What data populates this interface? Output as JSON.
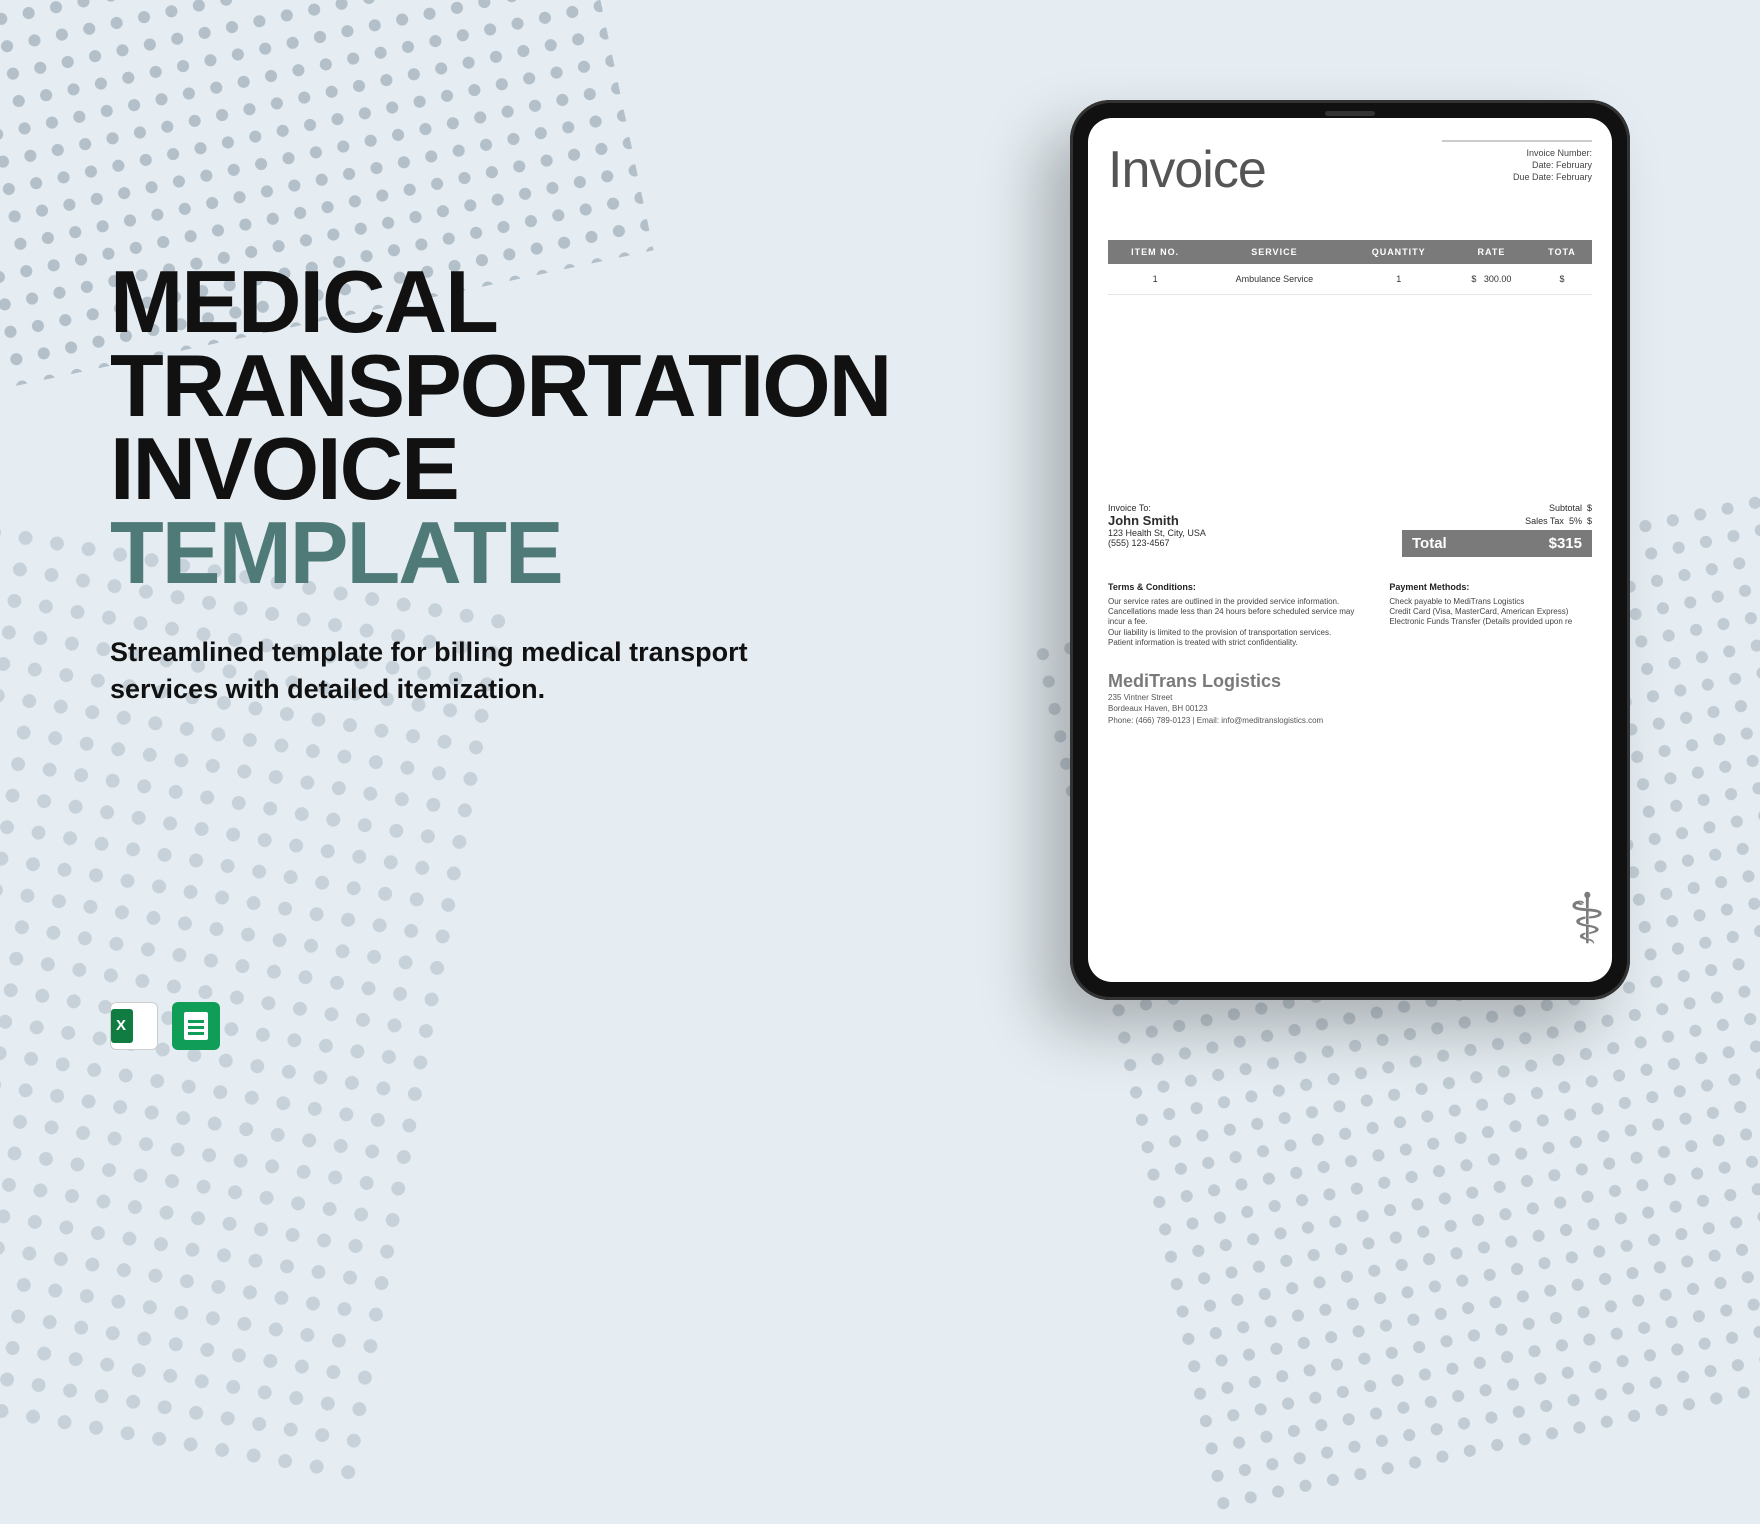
{
  "hero": {
    "title_line1": "MEDICAL",
    "title_line2": "TRANSPORTATION",
    "title_line3a": "INVOICE ",
    "title_line3b_accent": "TEMPLATE",
    "subtitle": "Streamlined template for billing medical transport services with detailed itemization."
  },
  "file_icons": {
    "excel": "excel-icon",
    "sheets": "google-sheets-icon"
  },
  "invoice": {
    "heading": "Invoice",
    "meta": {
      "number_label": "Invoice Number:",
      "date_label": "Date:",
      "date_value": "February",
      "due_label": "Due Date:",
      "due_value": "February"
    },
    "columns": {
      "item_no": "ITEM NO.",
      "service": "SERVICE",
      "quantity": "QUANTITY",
      "rate": "RATE",
      "total": "TOTA"
    },
    "row": {
      "item_no": "1",
      "service": "Ambulance Service",
      "quantity": "1",
      "rate_sym": "$",
      "rate": "300.00",
      "total_sym": "$"
    },
    "bill_to": {
      "label": "Invoice To:",
      "name": "John Smith",
      "addr": "123 Health St, City, USA",
      "phone": "(555) 123-4567"
    },
    "totals": {
      "subtotal_label": "Subtotal",
      "subtotal_sym": "$",
      "tax_label": "Sales Tax",
      "tax_pct": "5%",
      "tax_sym": "$",
      "total_label": "Total",
      "total_value": "$315"
    },
    "terms": {
      "heading": "Terms & Conditions:",
      "l1": "Our service rates are outlined in the provided service information.",
      "l2": "Cancellations made less than 24 hours before scheduled service may incur a fee.",
      "l3": "Our liability is limited to the provision of transportation services.",
      "l4": "Patient information is treated with strict confidentiality."
    },
    "payment": {
      "heading": "Payment Methods:",
      "l1": "Check payable to MediTrans Logistics",
      "l2": "Credit Card (Visa, MasterCard, American Express)",
      "l3": "Electronic Funds Transfer (Details provided upon re"
    },
    "company": {
      "name": "MediTrans Logistics",
      "addr1": "235 Vintner Street",
      "addr2": "Bordeaux Haven, BH 00123",
      "contact": "Phone: (466) 789-0123 | Email: info@meditranslogistics.com"
    }
  }
}
